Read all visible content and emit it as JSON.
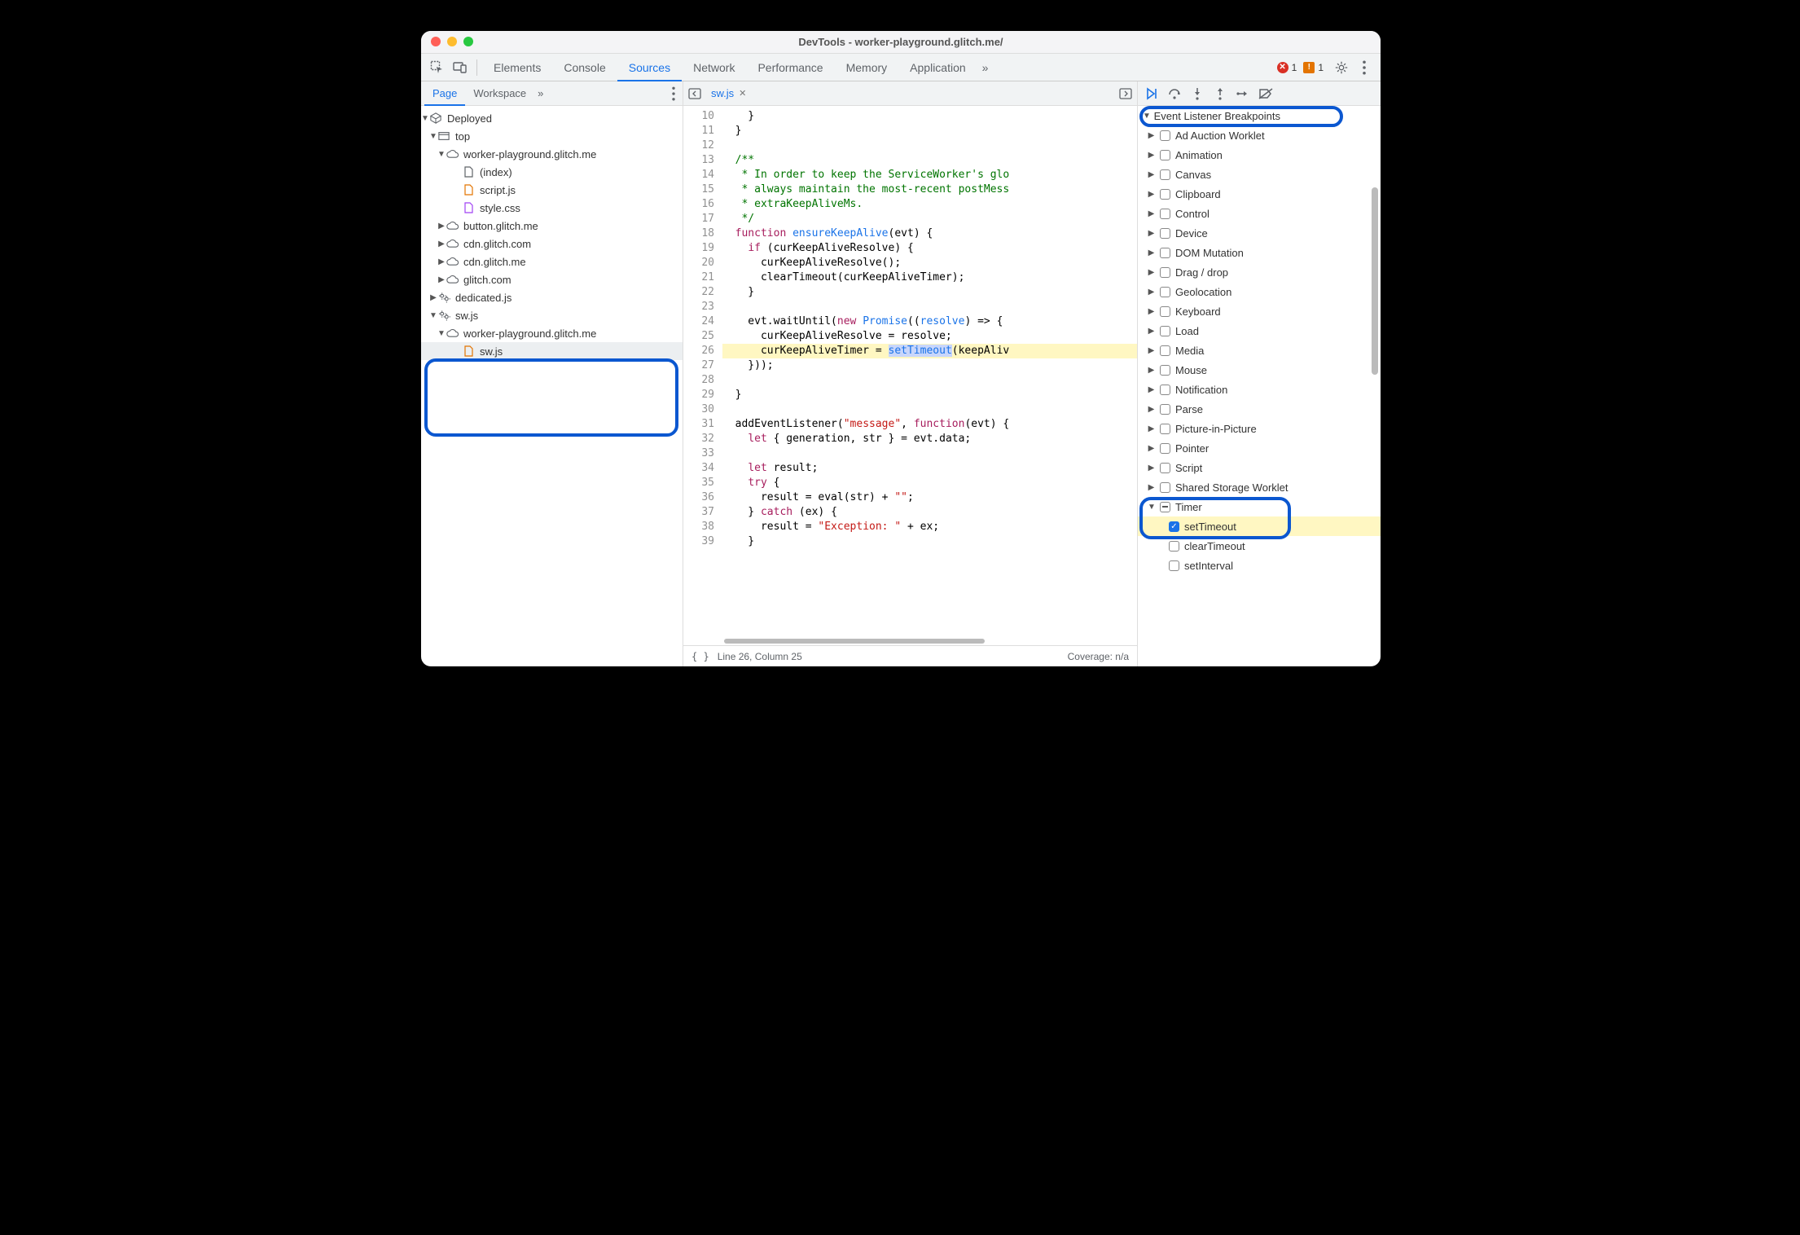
{
  "window": {
    "title": "DevTools - worker-playground.glitch.me/"
  },
  "tabs": {
    "items": [
      "Elements",
      "Console",
      "Sources",
      "Network",
      "Performance",
      "Memory",
      "Application"
    ],
    "active": "Sources",
    "more_glyph": "»"
  },
  "toolbar_right": {
    "error_count": "1",
    "warning_count": "1"
  },
  "sidebar": {
    "tabs": [
      "Page",
      "Workspace"
    ],
    "active": "Page",
    "more_glyph": "»",
    "tree": {
      "root": "Deployed",
      "top": "top",
      "origin1": "worker-playground.glitch.me",
      "files1": [
        "(index)",
        "script.js",
        "style.css"
      ],
      "origins": [
        "button.glitch.me",
        "cdn.glitch.com",
        "cdn.glitch.me",
        "glitch.com"
      ],
      "worker1": "dedicated.js",
      "worker2": "sw.js",
      "worker2_origin": "worker-playground.glitch.me",
      "worker2_file": "sw.js"
    }
  },
  "editor": {
    "tab_filename": "sw.js",
    "line_start": 10,
    "line_end": 39,
    "highlight_line": 26,
    "code": {
      "10": [
        [
          "op",
          "    }"
        ]
      ],
      "11": [
        [
          "op",
          "  }"
        ]
      ],
      "12": [
        [
          "op",
          ""
        ]
      ],
      "13": [
        [
          "cm",
          "  /**"
        ]
      ],
      "14": [
        [
          "cm",
          "   * In order to keep the ServiceWorker's glo"
        ]
      ],
      "15": [
        [
          "cm",
          "   * always maintain the most-recent postMess"
        ]
      ],
      "16": [
        [
          "cm",
          "   * extraKeepAliveMs."
        ]
      ],
      "17": [
        [
          "cm",
          "   */"
        ]
      ],
      "18": [
        [
          "kw",
          "  function "
        ],
        [
          "fn",
          "ensureKeepAlive"
        ],
        [
          "op",
          "("
        ],
        [
          "id",
          "evt"
        ],
        [
          "op",
          ") {"
        ]
      ],
      "19": [
        [
          "op",
          "    "
        ],
        [
          "kw",
          "if"
        ],
        [
          "op",
          " (curKeepAliveResolve) {"
        ]
      ],
      "20": [
        [
          "op",
          "      curKeepAliveResolve();"
        ]
      ],
      "21": [
        [
          "op",
          "      clearTimeout(curKeepAliveTimer);"
        ]
      ],
      "22": [
        [
          "op",
          "    }"
        ]
      ],
      "23": [
        [
          "op",
          ""
        ]
      ],
      "24": [
        [
          "op",
          "    evt.waitUntil("
        ],
        [
          "kw",
          "new"
        ],
        [
          "op",
          " "
        ],
        [
          "fn",
          "Promise"
        ],
        [
          "op",
          "(("
        ],
        [
          "fn",
          "resolve"
        ],
        [
          "op",
          ") => {"
        ]
      ],
      "25": [
        [
          "op",
          "      curKeepAliveResolve = resolve;"
        ]
      ],
      "26": [
        [
          "op",
          "      curKeepAliveTimer = "
        ],
        [
          "hlstart",
          ""
        ],
        [
          "fn",
          "setTimeout"
        ],
        [
          "hlend",
          ""
        ],
        [
          "op",
          "(keepAliv"
        ]
      ],
      "27": [
        [
          "op",
          "    }));"
        ]
      ],
      "28": [
        [
          "op",
          ""
        ]
      ],
      "29": [
        [
          "op",
          "  }"
        ]
      ],
      "30": [
        [
          "op",
          ""
        ]
      ],
      "31": [
        [
          "op",
          "  addEventListener("
        ],
        [
          "str",
          "\"message\""
        ],
        [
          "op",
          ", "
        ],
        [
          "kw",
          "function"
        ],
        [
          "op",
          "("
        ],
        [
          "id",
          "evt"
        ],
        [
          "op",
          ") {"
        ]
      ],
      "32": [
        [
          "op",
          "    "
        ],
        [
          "kw",
          "let"
        ],
        [
          "op",
          " { generation, str } = evt.data;"
        ]
      ],
      "33": [
        [
          "op",
          ""
        ]
      ],
      "34": [
        [
          "op",
          "    "
        ],
        [
          "kw",
          "let"
        ],
        [
          "op",
          " result;"
        ]
      ],
      "35": [
        [
          "op",
          "    "
        ],
        [
          "kw",
          "try"
        ],
        [
          "op",
          " {"
        ]
      ],
      "36": [
        [
          "op",
          "      result = eval(str) + "
        ],
        [
          "str",
          "\"\""
        ],
        [
          "op",
          ";"
        ]
      ],
      "37": [
        [
          "op",
          "    } "
        ],
        [
          "kw",
          "catch"
        ],
        [
          "op",
          " ("
        ],
        [
          "id",
          "ex"
        ],
        [
          "op",
          ") {"
        ]
      ],
      "38": [
        [
          "op",
          "      result = "
        ],
        [
          "str",
          "\"Exception: \""
        ],
        [
          "op",
          " + ex;"
        ]
      ],
      "39": [
        [
          "op",
          "    }"
        ]
      ]
    },
    "status": {
      "cursor": "Line 26, Column 25",
      "coverage": "Coverage: n/a"
    }
  },
  "debugger": {
    "section_title": "Event Listener Breakpoints",
    "categories": [
      "Ad Auction Worklet",
      "Animation",
      "Canvas",
      "Clipboard",
      "Control",
      "Device",
      "DOM Mutation",
      "Drag / drop",
      "Geolocation",
      "Keyboard",
      "Load",
      "Media",
      "Mouse",
      "Notification",
      "Parse",
      "Picture-in-Picture",
      "Pointer",
      "Script",
      "Shared Storage Worklet"
    ],
    "timer": {
      "label": "Timer",
      "items": [
        "setTimeout",
        "clearTimeout",
        "setInterval"
      ],
      "checked": "setTimeout"
    }
  }
}
